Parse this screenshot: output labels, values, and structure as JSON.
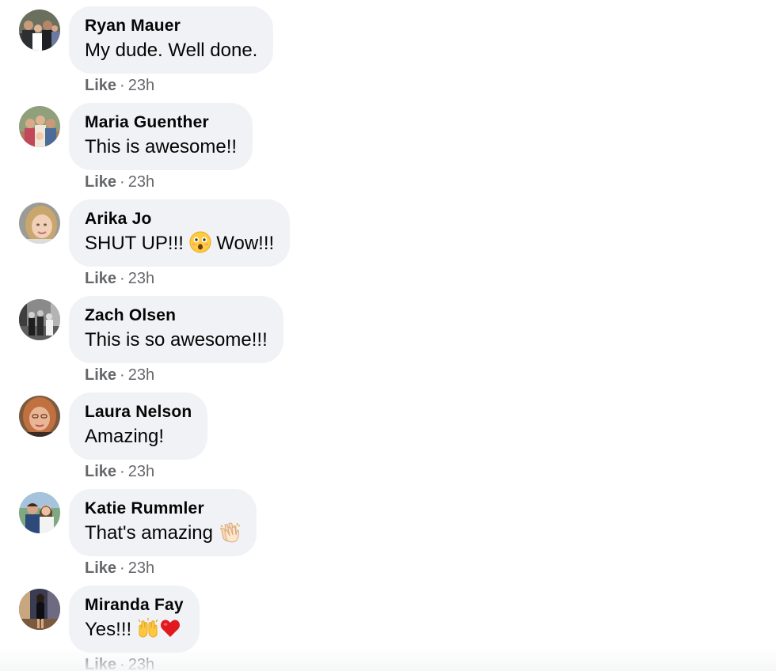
{
  "comments": [
    {
      "author": "Ryan Mauer",
      "text": "My dude. Well done.",
      "like_label": "Like",
      "separator": "·",
      "time": "23h",
      "avatar": "family-photo-avatar"
    },
    {
      "author": "Maria Guenther",
      "text": "This is awesome!!",
      "like_label": "Like",
      "separator": "·",
      "time": "23h",
      "avatar": "group-photo-avatar"
    },
    {
      "author": "Arika Jo",
      "text_before": "SHUT UP!!!",
      "emoji": "astonished-face-emoji",
      "text_after": "Wow!!!",
      "like_label": "Like",
      "separator": "·",
      "time": "23h",
      "avatar": "portrait-avatar"
    },
    {
      "author": "Zach Olsen",
      "text": "This is so awesome!!!",
      "like_label": "Like",
      "separator": "·",
      "time": "23h",
      "avatar": "black-and-white-group-avatar"
    },
    {
      "author": "Laura Nelson",
      "text": "Amazing!",
      "like_label": "Like",
      "separator": "·",
      "time": "23h",
      "avatar": "portrait-avatar"
    },
    {
      "author": "Katie Rummler",
      "text": "That's amazing",
      "emoji": "clapping-hands-emoji",
      "like_label": "Like",
      "separator": "·",
      "time": "23h",
      "avatar": "couple-photo-avatar"
    },
    {
      "author": "Miranda Fay",
      "text": "Yes!!!",
      "emojis": [
        "raising-hands-emoji",
        "red-heart-emoji"
      ],
      "like_label": "Like",
      "separator": "·",
      "time": "23h",
      "avatar": "standing-figure-avatar"
    }
  ],
  "colors": {
    "bubble": "#f0f2f5",
    "text": "#050505",
    "meta": "#65676b"
  }
}
